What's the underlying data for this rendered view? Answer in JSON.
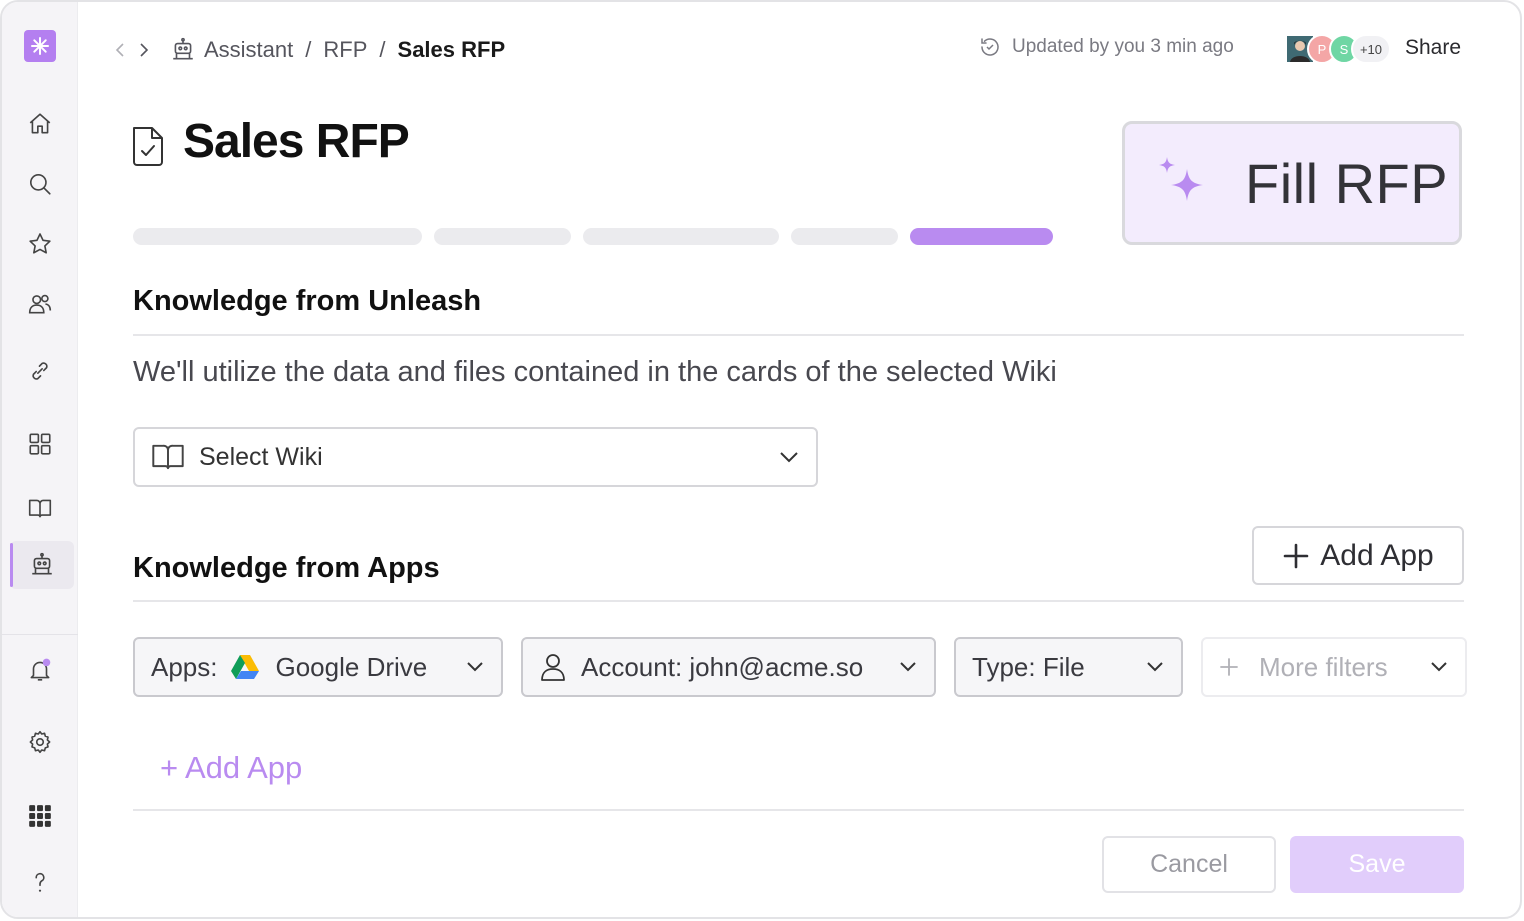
{
  "breadcrumb": {
    "items": [
      "Assistant",
      "RFP"
    ],
    "separator": "/",
    "current": "Sales RFP"
  },
  "header": {
    "updated_text": "Updated by you 3 min ago",
    "share_label": "Share",
    "avatars": [
      {
        "initial": "",
        "color": "#5a6b7a"
      },
      {
        "initial": "P",
        "color": "#f4a6a6"
      },
      {
        "initial": "S",
        "color": "#6fd6a4"
      },
      {
        "initial": "+10",
        "color": "#f1f1f4"
      }
    ]
  },
  "page": {
    "title": "Sales RFP",
    "fill_button": "Fill RFP"
  },
  "progress": {
    "steps": 5,
    "active_step": 5
  },
  "unleash": {
    "title": "Knowledge from Unleash",
    "description": "We'll utilize the data and files contained in the cards of the selected Wiki",
    "select_placeholder": "Select Wiki"
  },
  "apps": {
    "title": "Knowledge from Apps",
    "add_button": "Add App",
    "filters": {
      "apps_label": "Apps:",
      "apps_value": "Google Drive",
      "account": "Account: john@acme.so",
      "type": "Type: File",
      "more": "More filters"
    },
    "add_link": "+ Add App"
  },
  "footer": {
    "cancel": "Cancel",
    "save": "Save"
  },
  "colors": {
    "accent": "#b98bf0",
    "accent_light": "#f3ecfd"
  }
}
